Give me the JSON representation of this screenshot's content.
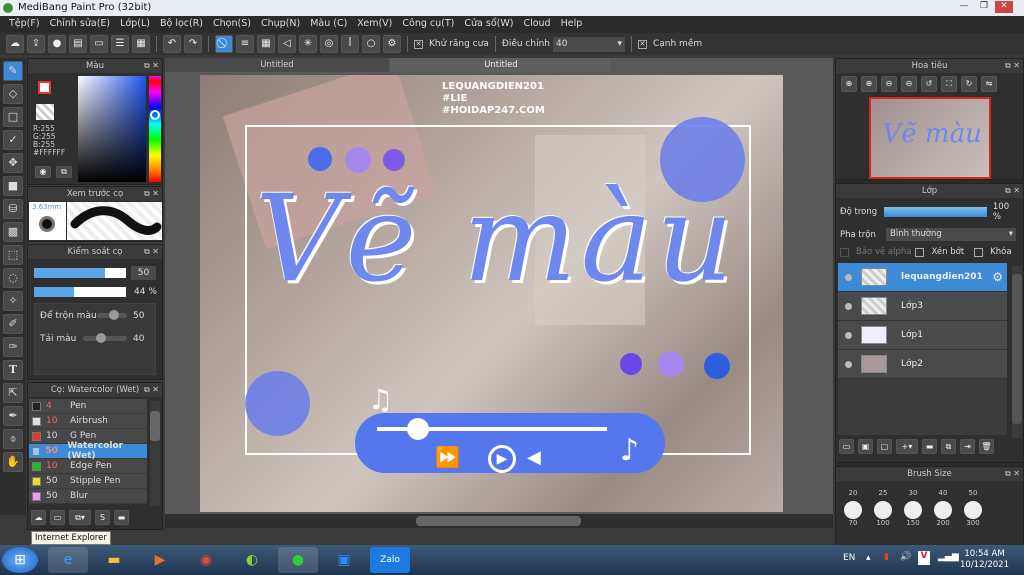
{
  "window": {
    "title": "MediBang Paint Pro (32bit)"
  },
  "menu": [
    "Tệp(F)",
    "Chỉnh sửa(E)",
    "Lớp(L)",
    "Bộ lọc(R)",
    "Chọn(S)",
    "Chụp(N)",
    "Màu (C)",
    "Xem(V)",
    "Công cụ(T)",
    "Cửa sổ(W)",
    "Cloud",
    "Help"
  ],
  "toolbar": {
    "antialias_label": "Khử răng cưa",
    "adjust_label": "Điều chỉnh",
    "adjust_value": "40",
    "soft_edge_label": "Cạnh mềm"
  },
  "color_panel": {
    "title": "Màu",
    "r": "R:255",
    "g": "G:255",
    "b": "B:255",
    "hex": "#FFFFFF"
  },
  "brush_preview": {
    "title": "Xem trước cọ",
    "size": "3.63mm"
  },
  "brush_control": {
    "title": "Kiểm soát cọ",
    "size_value": "50",
    "opacity_value": "44 %",
    "opacity_fraction": 0.44,
    "size_fraction": 0.7,
    "blend_label": "Để trộn màu",
    "blend_value": "50",
    "reload_label": "Tải màu",
    "reload_value": "40"
  },
  "brush_list": {
    "title": "Cọ: Watercolor (Wet)",
    "items": [
      {
        "size": "4",
        "name": "Pen",
        "color": "#222222"
      },
      {
        "size": "10",
        "name": "Airbrush",
        "color": "#dddddd"
      },
      {
        "size": "10",
        "name": "G Pen",
        "color": "#ee3333"
      },
      {
        "size": "50",
        "name": "Watercolor (Wet)",
        "color": "#88ccff",
        "selected": true
      },
      {
        "size": "10",
        "name": "Edge Pen",
        "color": "#22bb22"
      },
      {
        "size": "50",
        "name": "Stipple Pen",
        "color": "#eedd22"
      },
      {
        "size": "50",
        "name": "Blur",
        "color": "#ee99ee"
      }
    ]
  },
  "tooltip": "Internet Explorer",
  "canvas": {
    "tabs": [
      "Untitled",
      "Untitled"
    ],
    "watermark": [
      "LEQUANGDIEN201",
      "#LIE",
      "#HOIDAP247.COM"
    ],
    "art_title": "Vẽ màu"
  },
  "navigator": {
    "title": "Hoa tiêu"
  },
  "layers": {
    "title": "Lớp",
    "opacity_label": "Độ trong",
    "opacity_value": "100 %",
    "blend_label": "Pha trộn",
    "blend_value": "Bình thường",
    "protect_alpha": "Bảo vệ alpha",
    "clip": "Xén bớt",
    "lock": "Khóa",
    "items": [
      {
        "name": "lequangdien201",
        "selected": true
      },
      {
        "name": "Lớp3"
      },
      {
        "name": "Lớp1"
      },
      {
        "name": "Lớp2"
      }
    ]
  },
  "brush_size": {
    "title": "Brush Size",
    "row1": [
      "20",
      "25",
      "30",
      "40",
      "50"
    ],
    "row2": [
      "70",
      "100",
      "150",
      "200",
      "300"
    ]
  },
  "taskbar": {
    "lang": "EN",
    "time": "10:54 AM",
    "date": "10/12/2021"
  }
}
